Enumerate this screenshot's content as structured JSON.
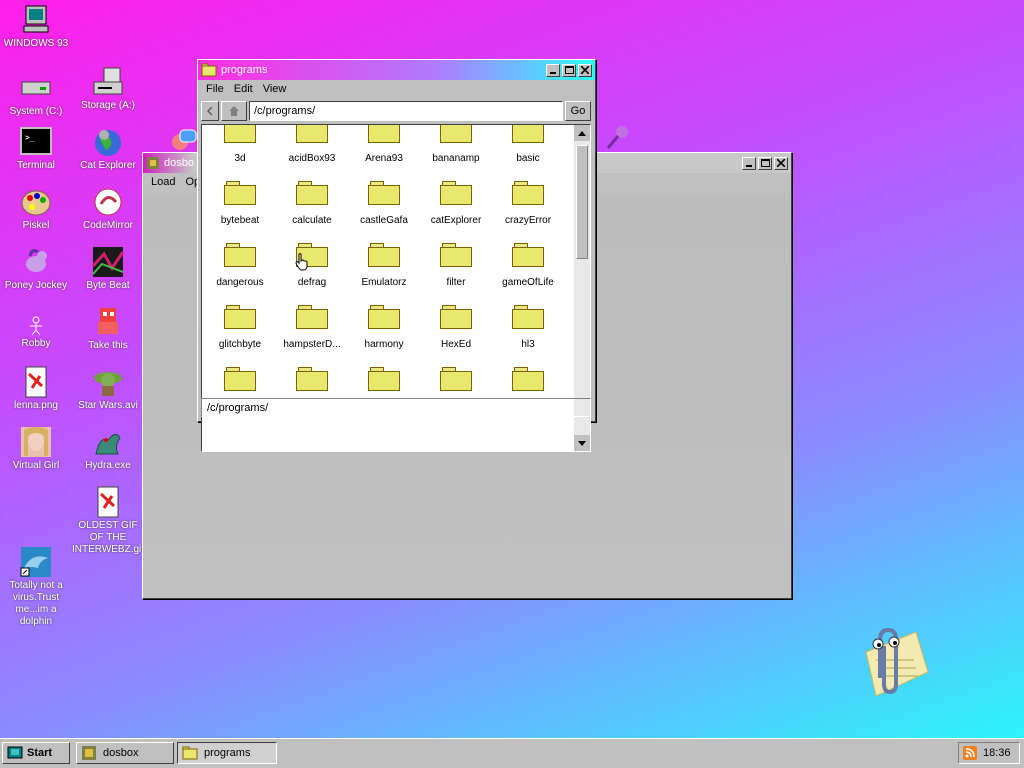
{
  "desktop": {
    "icons": [
      {
        "label": "WINDOWS 93",
        "icon": "computer-icon"
      },
      {
        "label": "System (C:)",
        "icon": "drive-icon"
      },
      {
        "label": "Storage (A:)",
        "icon": "floppy-drive-icon"
      },
      {
        "label": "Terminal",
        "icon": "terminal-icon"
      },
      {
        "label": "Cat Explorer",
        "icon": "cat-globe-icon"
      },
      {
        "label": "Piskel",
        "icon": "palette-icon"
      },
      {
        "label": "CodeMirror",
        "icon": "codemirror-icon"
      },
      {
        "label": "Poney Jockey",
        "icon": "pony-icon"
      },
      {
        "label": "Byte Beat",
        "icon": "bytebeat-icon"
      },
      {
        "label": "Robby",
        "icon": "stick-figure-icon"
      },
      {
        "label": "Take this",
        "icon": "pixel-character-icon"
      },
      {
        "label": "lenna.png",
        "icon": "image-file-icon"
      },
      {
        "label": "Star Wars.avi",
        "icon": "yoda-icon"
      },
      {
        "label": "Virtual Girl",
        "icon": "virtual-girl-icon"
      },
      {
        "label": "Hydra.exe",
        "icon": "hydra-icon"
      },
      {
        "label": "OLDEST GIF OF THE INTERWEBZ.gif",
        "icon": "gif-file-icon"
      },
      {
        "label": "Totally not a virus.Trust me...im a dolphin",
        "icon": "dolphin-icon"
      }
    ]
  },
  "dosbox_window": {
    "title": "dosbo",
    "menu": [
      "Load",
      "Op"
    ]
  },
  "programs_window": {
    "title": "programs",
    "menu": [
      "File",
      "Edit",
      "View"
    ],
    "address": "/c/programs/",
    "go_label": "Go",
    "status": "/c/programs/",
    "items": [
      "3d",
      "acidBox93",
      "Arena93",
      "bananamp",
      "basic",
      "bytebeat",
      "calculate",
      "castleGafa",
      "catExplorer",
      "crazyError",
      "dangerous",
      "defrag",
      "Emulatorz",
      "filter",
      "gameOfLife",
      "glitchbyte",
      "hampsterD...",
      "harmony",
      "HexEd",
      "hl3",
      "",
      "",
      "",
      "",
      ""
    ]
  },
  "taskbar": {
    "start_label": "Start",
    "tasks": [
      {
        "label": "dosbox",
        "icon": "dosbox-icon"
      },
      {
        "label": "programs",
        "icon": "folder-icon"
      }
    ],
    "clock": "18:36",
    "tray_icon": "rss-icon"
  },
  "colors": {
    "desktop_gradient": [
      "#ff1ee8",
      "#c44cff",
      "#25fdfb"
    ],
    "window_face": "#c0c0c0",
    "folder_yellow": "#e9e86e"
  }
}
